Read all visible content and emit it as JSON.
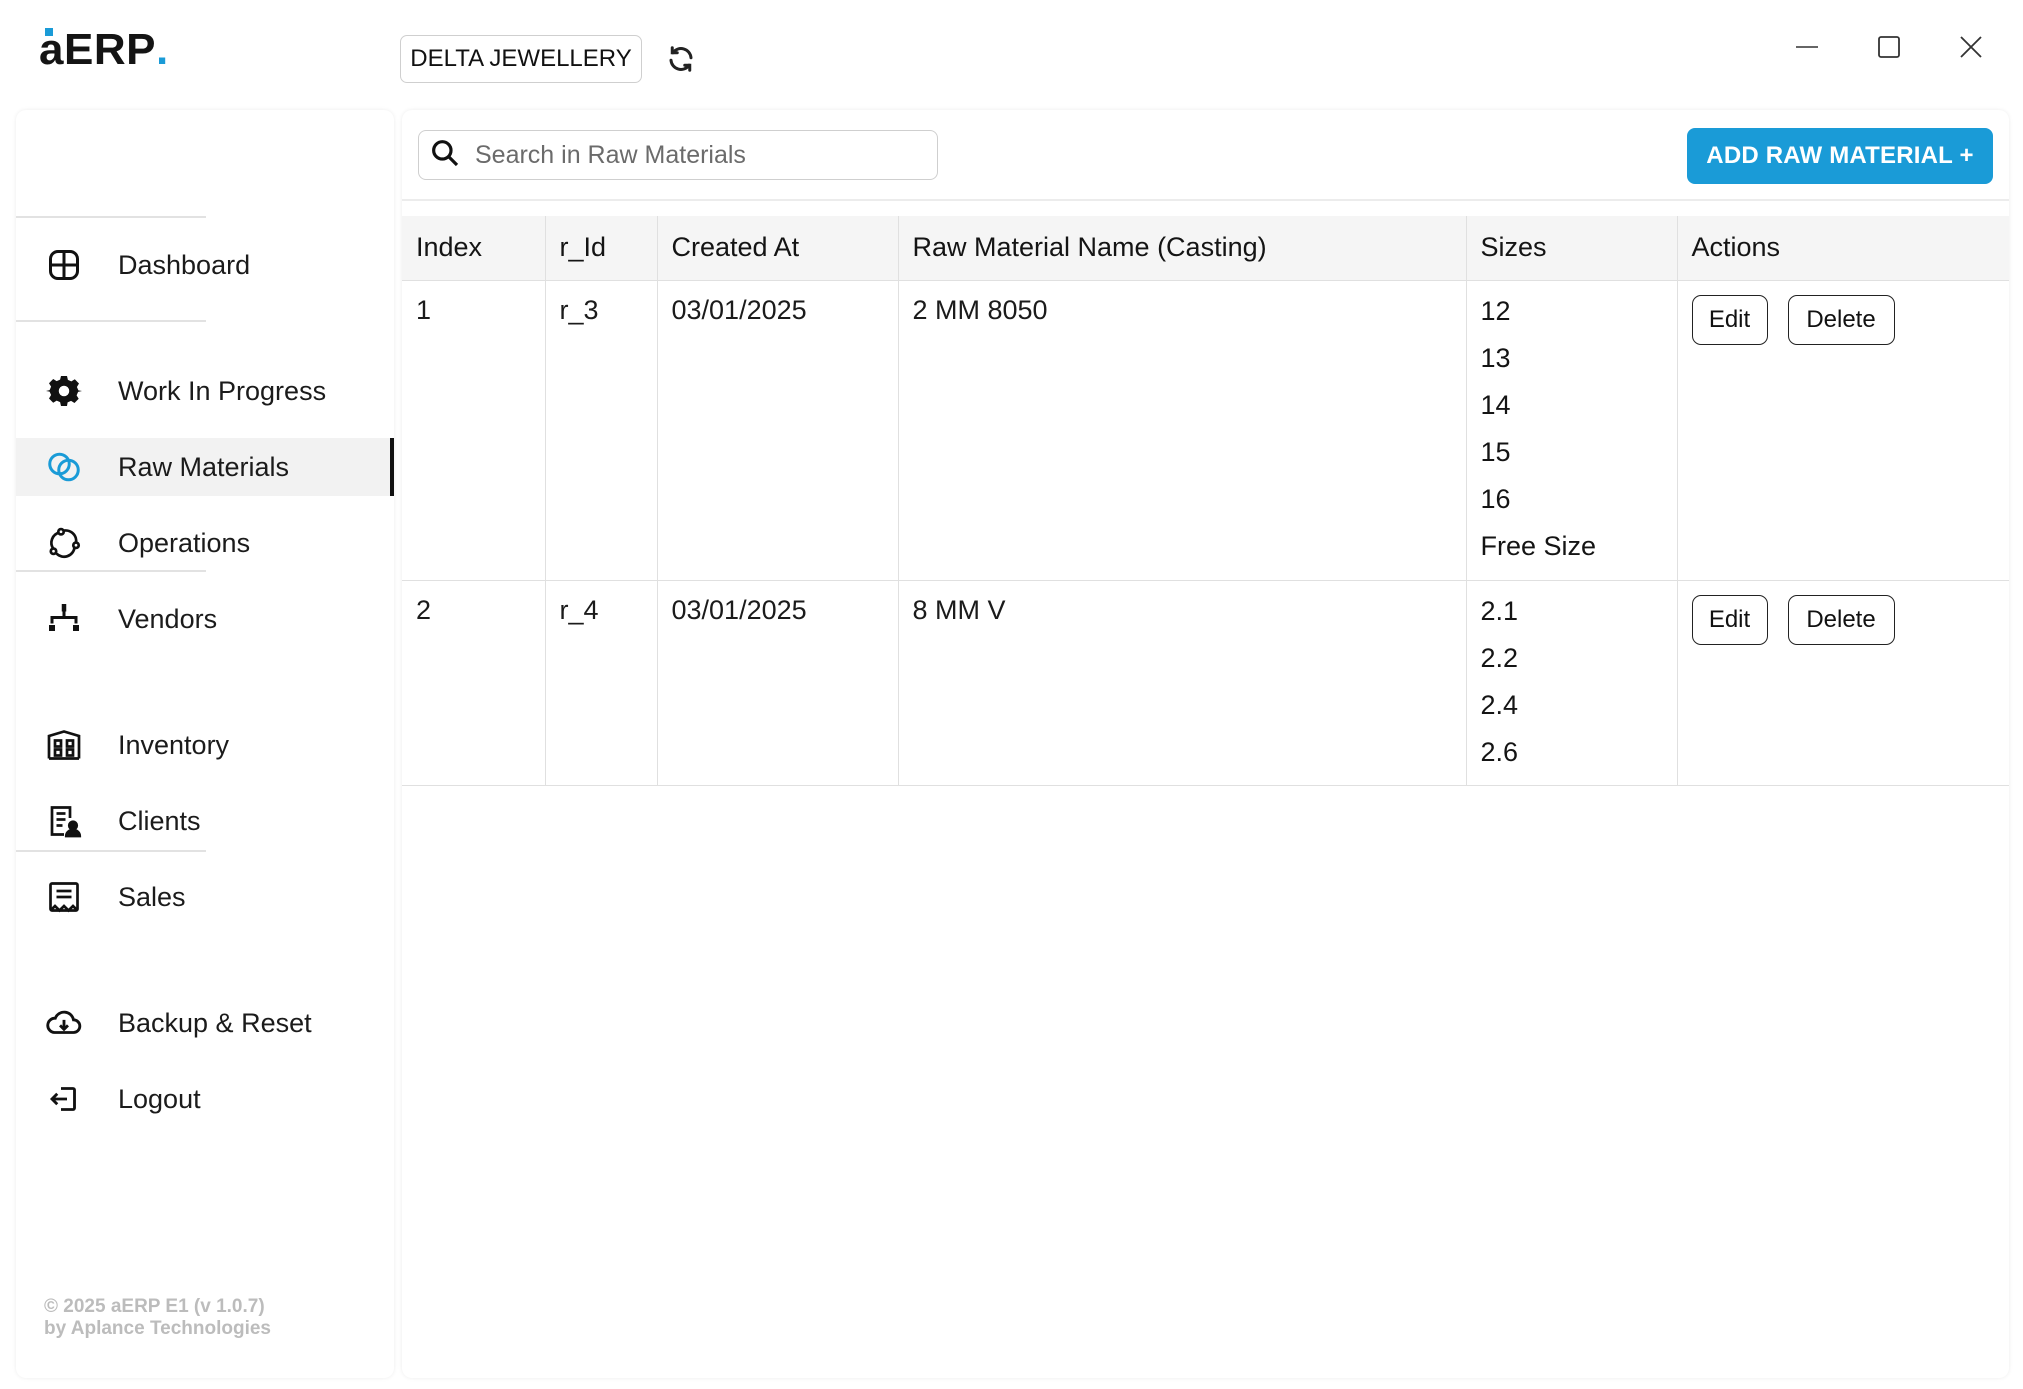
{
  "app": {
    "logo_text": "aERP",
    "logo_dot": ".",
    "company": "DELTA JEWELLERY",
    "accent_color": "#1a9bd7"
  },
  "window_controls": [
    "minimize-icon",
    "maximize-icon",
    "close-icon"
  ],
  "sidebar": {
    "items": [
      {
        "label": "Dashboard",
        "icon": "dashboard-icon"
      },
      {
        "label": "Work In Progress",
        "icon": "gear-icon"
      },
      {
        "label": "Raw Materials",
        "icon": "raw-materials-icon",
        "active": true
      },
      {
        "label": "Operations",
        "icon": "operations-icon"
      },
      {
        "label": "Vendors",
        "icon": "vendors-icon"
      },
      {
        "label": "Inventory",
        "icon": "inventory-icon"
      },
      {
        "label": "Clients",
        "icon": "clients-icon"
      },
      {
        "label": "Sales",
        "icon": "sales-icon"
      },
      {
        "label": "Backup & Reset",
        "icon": "cloud-icon"
      },
      {
        "label": "Logout",
        "icon": "logout-icon"
      }
    ],
    "footer": {
      "line1": "© 2025 aERP E1 (v 1.0.7)",
      "line2": "by Aplance Technologies"
    }
  },
  "main": {
    "search": {
      "placeholder": "Search in Raw Materials",
      "value": ""
    },
    "add_button": "ADD RAW MATERIAL +",
    "table": {
      "headers": [
        "Index",
        "r_Id",
        "Created At",
        "Raw Material Name (Casting)",
        "Sizes",
        "Actions"
      ],
      "rows": [
        {
          "index": "1",
          "r_id": "r_3",
          "created_at": "03/01/2025",
          "name": "2 MM 8050",
          "sizes": [
            "12",
            "13",
            "14",
            "15",
            "16",
            "Free Size"
          ],
          "edit": "Edit",
          "delete": "Delete"
        },
        {
          "index": "2",
          "r_id": "r_4",
          "created_at": "03/01/2025",
          "name": "8 MM V",
          "sizes": [
            "2.1",
            "2.2",
            "2.4",
            "2.6"
          ],
          "edit": "Edit",
          "delete": "Delete"
        }
      ]
    }
  }
}
